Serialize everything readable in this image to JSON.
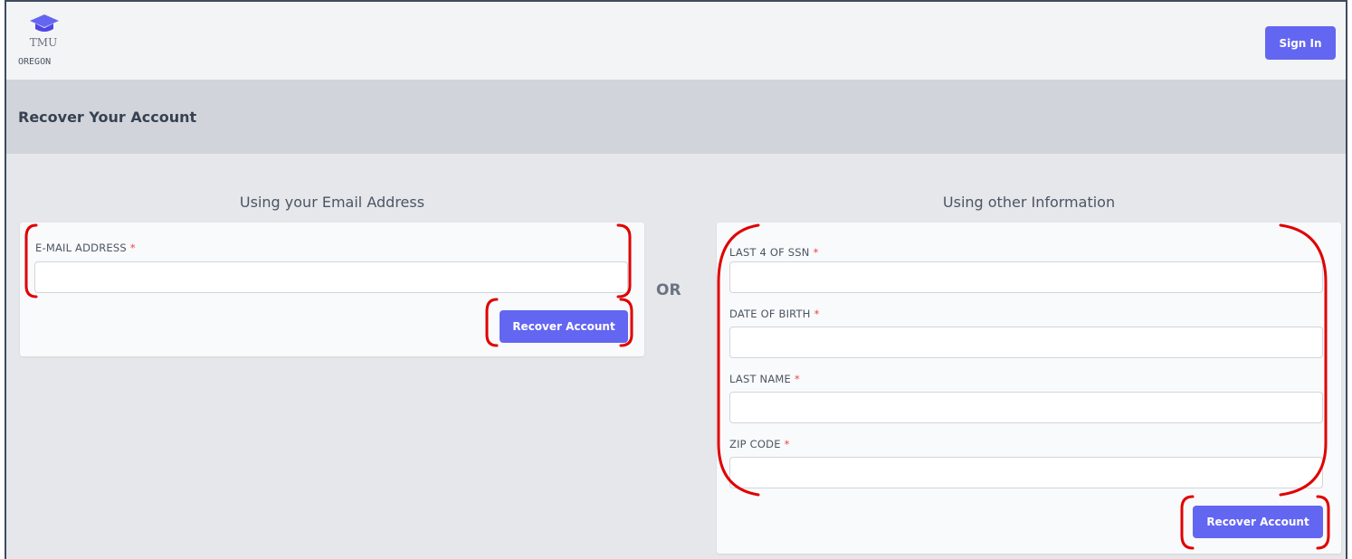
{
  "header": {
    "logo_text": "TMU",
    "logo_sub": "OREGON",
    "signin_label": "Sign In"
  },
  "page": {
    "title": "Recover Your Account"
  },
  "email_section": {
    "heading": "Using your Email Address",
    "field_label": "E-MAIL ADDRESS",
    "required_mark": "*",
    "field_value": "",
    "button_label": "Recover Account"
  },
  "separator": "OR",
  "other_section": {
    "heading": "Using other Information",
    "fields": [
      {
        "label": "LAST 4 OF SSN",
        "required_mark": "*",
        "value": ""
      },
      {
        "label": "DATE OF BIRTH",
        "required_mark": "*",
        "value": ""
      },
      {
        "label": "LAST NAME",
        "required_mark": "*",
        "value": ""
      },
      {
        "label": "ZIP CODE",
        "required_mark": "*",
        "value": ""
      }
    ],
    "button_label": "Recover Account"
  },
  "colors": {
    "accent": "#6366f1",
    "required": "#ef4444",
    "annotation": "#e00000"
  }
}
